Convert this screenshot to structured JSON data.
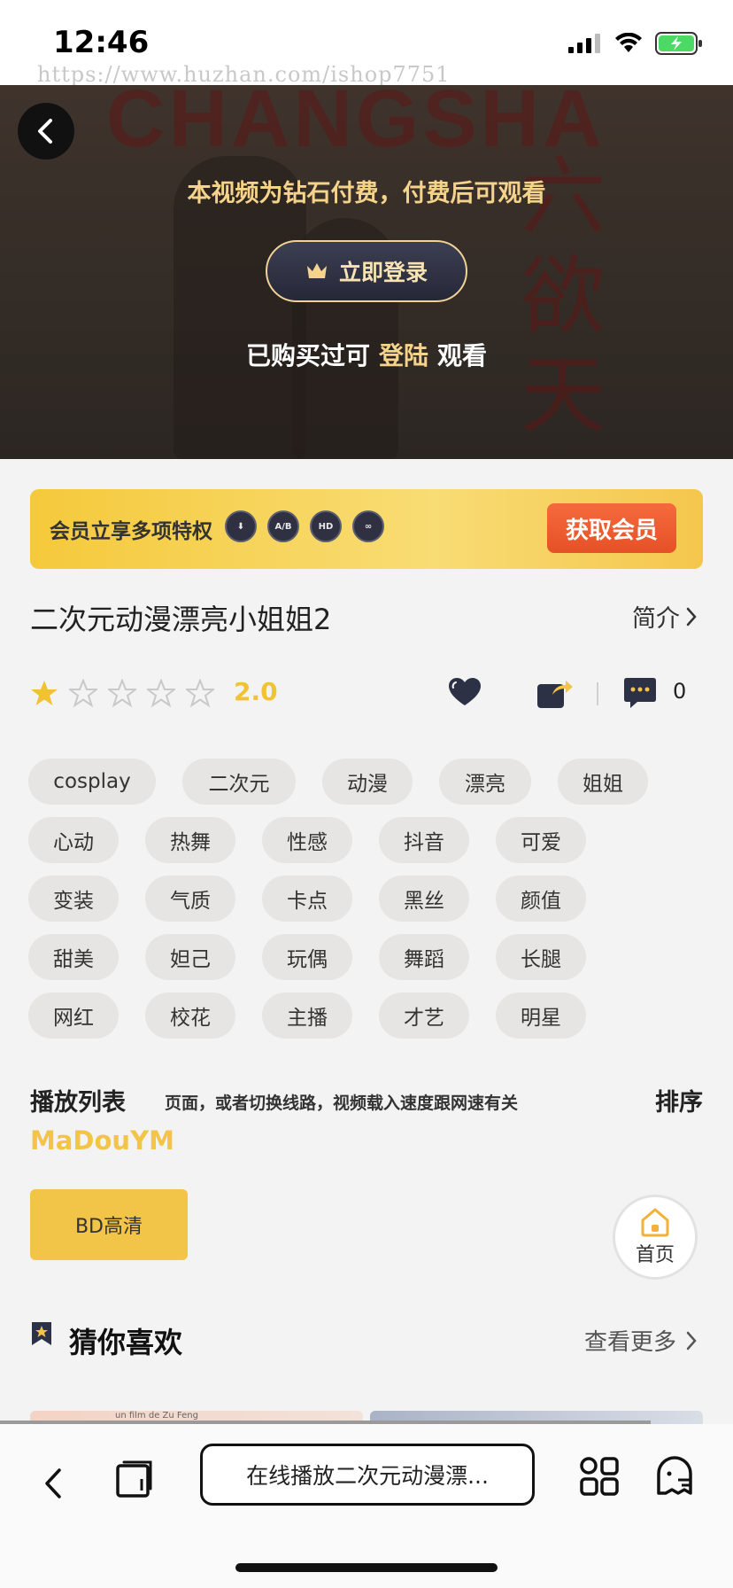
{
  "status_bar": {
    "time": "12:46"
  },
  "watermark": "https://www.huzhan.com/ishop7751",
  "hero": {
    "poster_title": "CHANGSHA",
    "poster_cn": "六欲天",
    "paywall_message": "本视频为钻石付费，付费后可观看",
    "login_button": "立即登录",
    "purchased_prefix": "已购买过可",
    "purchased_link": "登陆",
    "purchased_suffix": "观看"
  },
  "member_banner": {
    "text": "会员立享多项特权",
    "perks": [
      "download-icon",
      "subtitle-icon",
      "hd-icon",
      "infinite-download-icon"
    ],
    "perk_labels": [
      "⬇",
      "A/B",
      "HD",
      "∞"
    ],
    "join_button": "获取会员"
  },
  "video": {
    "title": "二次元动漫漂亮小姐姐2",
    "intro_link": "简介",
    "rating": 2.0,
    "rating_text": "2.0",
    "stars_filled": 1,
    "stars_total": 5,
    "comment_count": "0"
  },
  "tags": [
    "cosplay",
    "二次元",
    "动漫",
    "漂亮",
    "姐姐",
    "心动",
    "热舞",
    "性感",
    "抖音",
    "可爱",
    "变装",
    "气质",
    "卡点",
    "黑丝",
    "颜值",
    "甜美",
    "妲己",
    "玩偶",
    "舞蹈",
    "长腿",
    "网红",
    "校花",
    "主播",
    "才艺",
    "明星"
  ],
  "playlist": {
    "title": "播放列表",
    "marquee": "页面，或者切换线路，视频载入速度跟网速有关",
    "sort": "排序",
    "source": "MaDouYM",
    "quality_button": "BD高清"
  },
  "home_float": {
    "label": "首页"
  },
  "recommend": {
    "title": "猜你喜欢",
    "more": "查看更多",
    "thumb_caption": "un film de Zu Feng"
  },
  "browser": {
    "address": "在线播放二次元动漫漂..."
  },
  "colors": {
    "accent_gold": "#f2c447",
    "cta_orange": "#e65127",
    "paywall_gold": "#f5d38a"
  }
}
